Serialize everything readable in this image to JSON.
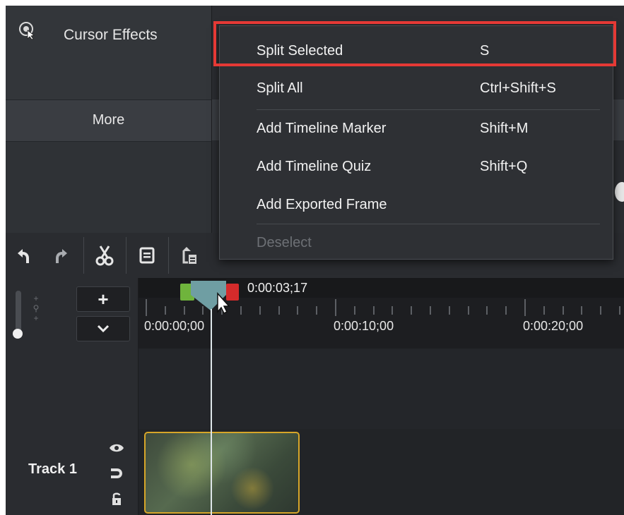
{
  "tools_panel": {
    "cursor_effects_label": "Cursor Effects",
    "more_label": "More"
  },
  "context_menu": {
    "items": [
      {
        "label": "Split Selected",
        "shortcut": "S",
        "enabled": true,
        "highlighted": true
      },
      {
        "label": "Split All",
        "shortcut": "Ctrl+Shift+S",
        "enabled": true
      },
      {
        "label": "Add Timeline Marker",
        "shortcut": "Shift+M",
        "enabled": true
      },
      {
        "label": "Add Timeline Quiz",
        "shortcut": "Shift+Q",
        "enabled": true
      },
      {
        "label": "Add Exported Frame",
        "shortcut": "",
        "enabled": true
      },
      {
        "label": "Deselect",
        "shortcut": "",
        "enabled": false
      }
    ]
  },
  "toolbar": {
    "icons": [
      "undo-icon",
      "redo-icon",
      "cut-icon",
      "copy-icon",
      "paste-icon"
    ]
  },
  "timeline": {
    "playhead_time": "0:00:03;17",
    "ruler_labels": [
      "0:00:00;00",
      "0:00:10;00",
      "0:00:20;00"
    ],
    "zoom_in_label": "+",
    "zoom_out_label": "⌄"
  },
  "tracks": [
    {
      "label": "Track 1"
    }
  ],
  "colors": {
    "highlight": "#e53935",
    "clip_border": "#d7a629",
    "playhead_start": "#6fb43c",
    "playhead_end": "#d42b2b"
  }
}
